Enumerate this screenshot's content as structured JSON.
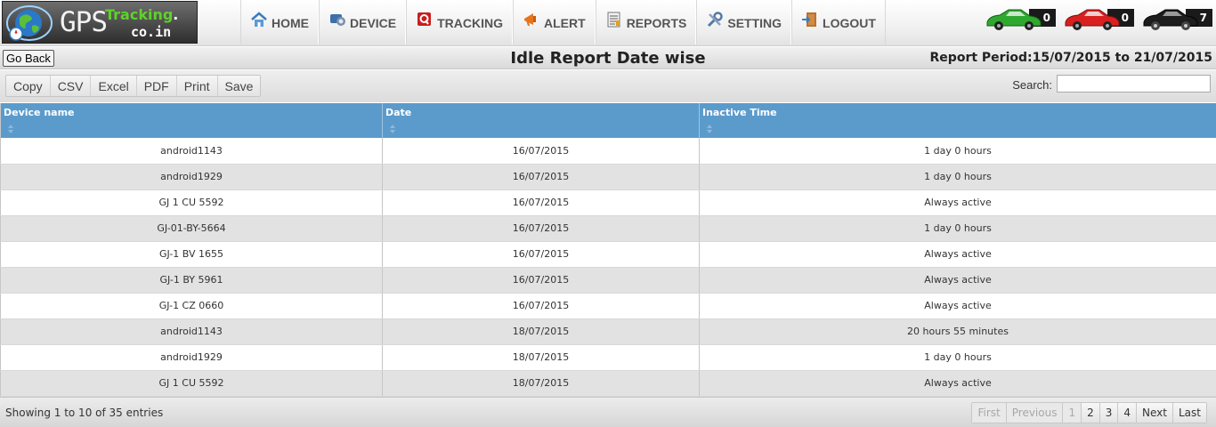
{
  "brand": {
    "gps": "GPS",
    "tracking": "Tracking",
    "dot": ".",
    "domain": "co.in"
  },
  "nav": [
    {
      "id": "home",
      "label": "HOME",
      "icon": "home-icon"
    },
    {
      "id": "device",
      "label": "DEVICE",
      "icon": "device-icon"
    },
    {
      "id": "tracking",
      "label": "TRACKING",
      "icon": "tracking-icon"
    },
    {
      "id": "alert",
      "label": "ALERT",
      "icon": "alert-icon"
    },
    {
      "id": "reports",
      "label": "REPORTS",
      "icon": "reports-icon"
    },
    {
      "id": "setting",
      "label": "SETTING",
      "icon": "setting-icon"
    },
    {
      "id": "logout",
      "label": "LOGOUT",
      "icon": "logout-icon"
    }
  ],
  "status_cars": [
    {
      "color": "#2fa82f",
      "count": "0",
      "icon": "green-car-icon"
    },
    {
      "color": "#d92020",
      "count": "0",
      "icon": "red-car-icon"
    },
    {
      "color": "#1d1d1d",
      "count": "7",
      "icon": "black-car-icon"
    }
  ],
  "report": {
    "go_back": "Go Back",
    "title": "Idle Report Date wise",
    "period": "Report Period:15/07/2015 to 21/07/2015"
  },
  "toolbar": {
    "buttons": [
      "Copy",
      "CSV",
      "Excel",
      "PDF",
      "Print",
      "Save"
    ],
    "search_label": "Search:",
    "search_value": ""
  },
  "table": {
    "columns": [
      "Device name",
      "Date",
      "Inactive Time"
    ],
    "rows": [
      [
        "android1143",
        "16/07/2015",
        "1 day 0 hours"
      ],
      [
        "android1929",
        "16/07/2015",
        "1 day 0 hours"
      ],
      [
        "GJ 1 CU 5592",
        "16/07/2015",
        "Always active"
      ],
      [
        "GJ-01-BY-5664",
        "16/07/2015",
        "1 day 0 hours"
      ],
      [
        "GJ-1 BV 1655",
        "16/07/2015",
        "Always active"
      ],
      [
        "GJ-1 BY 5961",
        "16/07/2015",
        "Always active"
      ],
      [
        "GJ-1 CZ 0660",
        "16/07/2015",
        "Always active"
      ],
      [
        "android1143",
        "18/07/2015",
        "20 hours 55 minutes"
      ],
      [
        "android1929",
        "18/07/2015",
        "1 day 0 hours"
      ],
      [
        "GJ 1 CU 5592",
        "18/07/2015",
        "Always active"
      ]
    ]
  },
  "footer": {
    "info": "Showing 1 to 10 of 35 entries",
    "pages": [
      {
        "label": "First",
        "disabled": true
      },
      {
        "label": "Previous",
        "disabled": true
      },
      {
        "label": "1",
        "disabled": true
      },
      {
        "label": "2",
        "disabled": false
      },
      {
        "label": "3",
        "disabled": false
      },
      {
        "label": "4",
        "disabled": false
      },
      {
        "label": "Next",
        "disabled": false
      },
      {
        "label": "Last",
        "disabled": false
      }
    ]
  }
}
